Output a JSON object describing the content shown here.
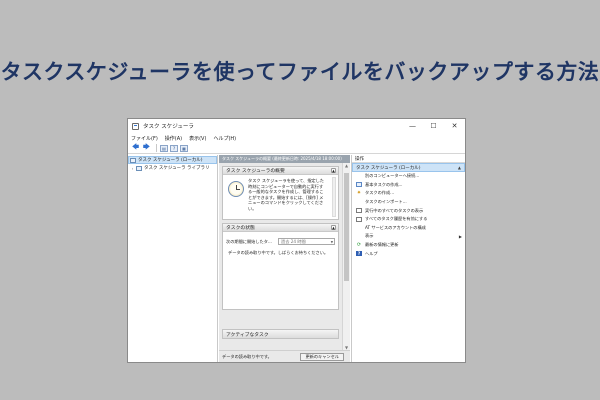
{
  "headline": "タスクスケジューラを使ってファイルをバックアップする方法",
  "window": {
    "title": "タスク スケジューラ",
    "controls": {
      "minimize": "—",
      "maximize": "☐",
      "close": "✕"
    }
  },
  "menu": [
    "ファイル(F)",
    "操作(A)",
    "表示(V)",
    "ヘルプ(H)"
  ],
  "toolbar": {
    "back": "🡄",
    "forward": "🡆",
    "b1": "▤",
    "b2": "?",
    "b3": "▦"
  },
  "tree": {
    "items": [
      {
        "label": "タスク スケジューラ (ローカル)",
        "selected": true,
        "arrow": ""
      },
      {
        "label": "タスク スケジューラ ライブラリ",
        "selected": false,
        "arrow": "›"
      }
    ]
  },
  "center": {
    "header": "タスク スケジューラの概要 (最終更新日時: 2025/4/18 18:00:00)",
    "overview": {
      "title": "タスク スケジューラの概要",
      "text": "タスク スケジューラを使って、指定した時刻にコンピューターで自動的に実行する一般的なタスクを作成し、管理することができます。開始するには、[操作] メニューのコマンドをクリックしてください。",
      "collapse": "▲"
    },
    "status": {
      "title": "タスクの状態",
      "collapse": "▲",
      "label": "次の期間に開始したタ...",
      "select": "過去 24 時間",
      "loading": "データの読み取り中です。しばらくお待ちください。"
    },
    "extra": "アクティブなタスク",
    "footer": "データの読み取り中です。",
    "refresh_button": "更新のキャンセル"
  },
  "actions": {
    "title": "操作",
    "group": "タスク スケジューラ (ローカル)",
    "group_arrow": "▲",
    "items": [
      {
        "label": "別のコンピューターへ接続...",
        "icon": "none"
      },
      {
        "label": "基本タスクの作成...",
        "icon": "blue"
      },
      {
        "label": "タスクの作成...",
        "icon": "star"
      },
      {
        "label": "タスクのインポート...",
        "icon": "none"
      },
      {
        "label": "実行中のすべてのタスクの表示",
        "icon": "list"
      },
      {
        "label": "すべてのタスク履歴を有効にする",
        "icon": "list"
      },
      {
        "label": "AT サービスのアカウントの構成",
        "icon": "none"
      },
      {
        "label": "表示",
        "icon": "none",
        "submenu": "▶"
      },
      {
        "label": "最新の情報に更新",
        "icon": "refresh"
      },
      {
        "label": "ヘルプ",
        "icon": "help"
      }
    ],
    "icons": {
      "blue": "▭",
      "star": "✷",
      "list": "▤",
      "refresh": "⟳",
      "help": "?"
    }
  }
}
